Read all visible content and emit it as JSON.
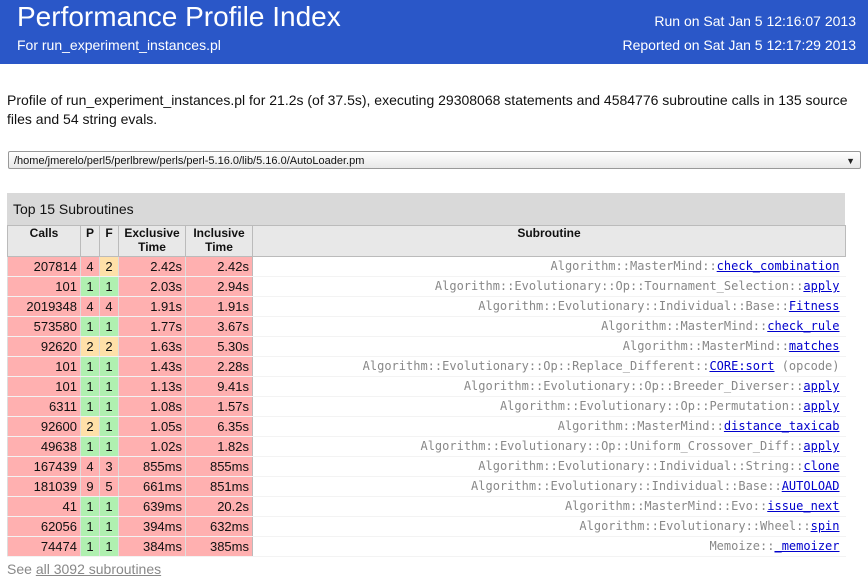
{
  "header": {
    "title": "Performance Profile Index",
    "subtitle": "For run_experiment_instances.pl",
    "run_on": "Run on Sat Jan 5 12:16:07 2013",
    "reported_on": "Reported on Sat Jan 5 12:17:29 2013",
    "background_color": "#2a57c8"
  },
  "summary": "Profile of run_experiment_instances.pl for 21.2s (of 37.5s), executing 29308068 statements and 4584776 subroutine calls in 135 source files and 54 string evals.",
  "file_select": {
    "value": "/home/jmerelo/perl5/perlbrew/perls/perl-5.16.0/lib/5.16.0/AutoLoader.pm"
  },
  "table": {
    "caption": "Top 15 Subroutines",
    "columns": {
      "calls": "Calls",
      "p": "P",
      "f": "F",
      "exclusive_line1": "Exclusive",
      "exclusive_line2": "Time",
      "inclusive_line1": "Inclusive",
      "inclusive_line2": "Time",
      "subroutine": "Subroutine"
    },
    "colors": {
      "red": "#ffb0b0",
      "green": "#b0f0b0",
      "orange": "#ffe0a8"
    },
    "rows": [
      {
        "calls": "207814",
        "p": "4",
        "f": "2",
        "excl": "2.42s",
        "incl": "2.42s",
        "pkg": "Algorithm::MasterMind::",
        "name": "check_combination",
        "extra": "",
        "pc": "red",
        "fc": "orange"
      },
      {
        "calls": "101",
        "p": "1",
        "f": "1",
        "excl": "2.03s",
        "incl": "2.94s",
        "pkg": "Algorithm::Evolutionary::Op::Tournament_Selection::",
        "name": "apply",
        "extra": "",
        "pc": "green",
        "fc": "green"
      },
      {
        "calls": "2019348",
        "p": "4",
        "f": "4",
        "excl": "1.91s",
        "incl": "1.91s",
        "pkg": "Algorithm::Evolutionary::Individual::Base::",
        "name": "Fitness",
        "extra": "",
        "pc": "red",
        "fc": "red"
      },
      {
        "calls": "573580",
        "p": "1",
        "f": "1",
        "excl": "1.77s",
        "incl": "3.67s",
        "pkg": "Algorithm::MasterMind::",
        "name": "check_rule",
        "extra": "",
        "pc": "green",
        "fc": "green"
      },
      {
        "calls": "92620",
        "p": "2",
        "f": "2",
        "excl": "1.63s",
        "incl": "5.30s",
        "pkg": "Algorithm::MasterMind::",
        "name": "matches",
        "extra": "",
        "pc": "orange",
        "fc": "orange"
      },
      {
        "calls": "101",
        "p": "1",
        "f": "1",
        "excl": "1.43s",
        "incl": "2.28s",
        "pkg": "Algorithm::Evolutionary::Op::Replace_Different::",
        "name": "CORE:sort",
        "extra": " (opcode)",
        "pc": "green",
        "fc": "green"
      },
      {
        "calls": "101",
        "p": "1",
        "f": "1",
        "excl": "1.13s",
        "incl": "9.41s",
        "pkg": "Algorithm::Evolutionary::Op::Breeder_Diverser::",
        "name": "apply",
        "extra": "",
        "pc": "green",
        "fc": "green"
      },
      {
        "calls": "6311",
        "p": "1",
        "f": "1",
        "excl": "1.08s",
        "incl": "1.57s",
        "pkg": "Algorithm::Evolutionary::Op::Permutation::",
        "name": "apply",
        "extra": "",
        "pc": "green",
        "fc": "green"
      },
      {
        "calls": "92600",
        "p": "2",
        "f": "1",
        "excl": "1.05s",
        "incl": "6.35s",
        "pkg": "Algorithm::MasterMind::",
        "name": "distance_taxicab",
        "extra": "",
        "pc": "orange",
        "fc": "green"
      },
      {
        "calls": "49638",
        "p": "1",
        "f": "1",
        "excl": "1.02s",
        "incl": "1.82s",
        "pkg": "Algorithm::Evolutionary::Op::Uniform_Crossover_Diff::",
        "name": "apply",
        "extra": "",
        "pc": "green",
        "fc": "green"
      },
      {
        "calls": "167439",
        "p": "4",
        "f": "3",
        "excl": "855ms",
        "incl": "855ms",
        "pkg": "Algorithm::Evolutionary::Individual::String::",
        "name": "clone",
        "extra": "",
        "pc": "red",
        "fc": "red"
      },
      {
        "calls": "181039",
        "p": "9",
        "f": "5",
        "excl": "661ms",
        "incl": "851ms",
        "pkg": "Algorithm::Evolutionary::Individual::Base::",
        "name": "AUTOLOAD",
        "extra": "",
        "pc": "red",
        "fc": "red"
      },
      {
        "calls": "41",
        "p": "1",
        "f": "1",
        "excl": "639ms",
        "incl": "20.2s",
        "pkg": "Algorithm::MasterMind::Evo::",
        "name": "issue_next",
        "extra": "",
        "pc": "green",
        "fc": "green"
      },
      {
        "calls": "62056",
        "p": "1",
        "f": "1",
        "excl": "394ms",
        "incl": "632ms",
        "pkg": "Algorithm::Evolutionary::Wheel::",
        "name": "spin",
        "extra": "",
        "pc": "green",
        "fc": "green"
      },
      {
        "calls": "74474",
        "p": "1",
        "f": "1",
        "excl": "384ms",
        "incl": "385ms",
        "pkg": "Memoize::",
        "name": "_memoizer",
        "extra": "",
        "pc": "green",
        "fc": "green"
      }
    ]
  },
  "footer": {
    "prefix": "See ",
    "link": "all 3092 subroutines"
  }
}
